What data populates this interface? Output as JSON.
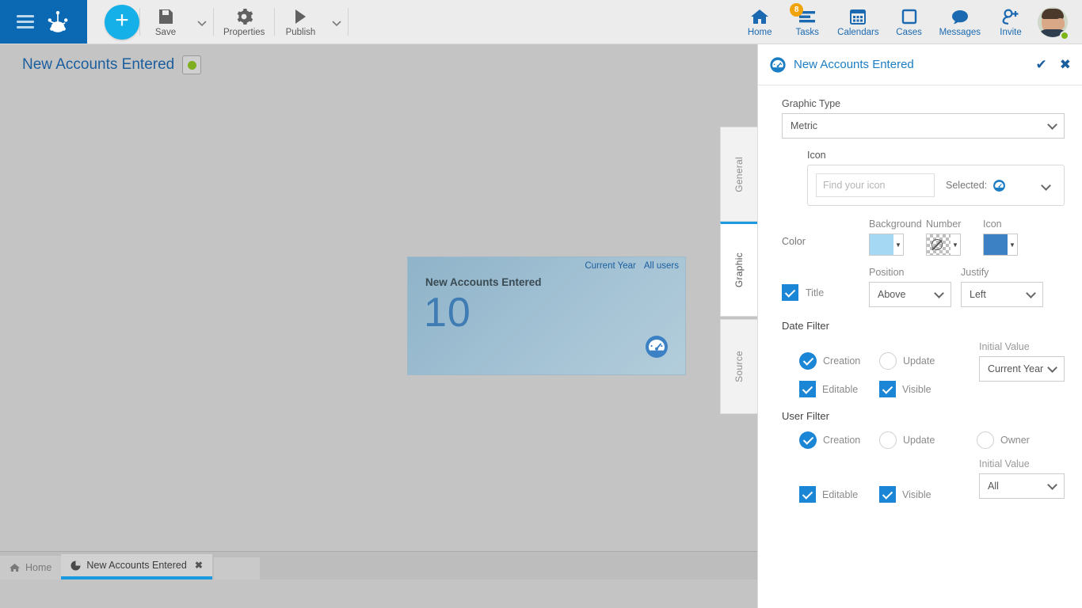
{
  "topbar": {
    "menu_icon": "hamburger-icon",
    "logo_icon": "frog-foot-logo",
    "add_label": "+",
    "left_tools": [
      {
        "label": "Save",
        "icon": "save-icon",
        "has_caret": true
      },
      {
        "label": "Properties",
        "icon": "gear-icon",
        "has_caret": false
      },
      {
        "label": "Publish",
        "icon": "play-icon",
        "has_caret": true
      }
    ],
    "right_tools": [
      {
        "label": "Home",
        "icon": "home-icon",
        "badge": ""
      },
      {
        "label": "Tasks",
        "icon": "tasks-icon",
        "badge": "8"
      },
      {
        "label": "Calendars",
        "icon": "calendar-icon",
        "badge": ""
      },
      {
        "label": "Cases",
        "icon": "square-icon",
        "badge": ""
      },
      {
        "label": "Messages",
        "icon": "speech-bubble-icon",
        "badge": ""
      },
      {
        "label": "Invite",
        "icon": "person-add-icon",
        "badge": ""
      }
    ],
    "avatar_name": "user-avatar",
    "status": "online"
  },
  "canvas": {
    "page_title": "New Accounts Entered",
    "status_color": "#7fae20",
    "widget": {
      "title": "New Accounts Entered",
      "value": "10",
      "icon": "gauge-icon",
      "date_filter": "Current Year",
      "user_filter": "All users"
    },
    "vtabs": [
      {
        "label": "General",
        "active": false
      },
      {
        "label": "Graphic",
        "active": true
      },
      {
        "label": "Source",
        "active": false
      }
    ]
  },
  "panel": {
    "icon": "gauge-icon",
    "title": "New Accounts Entered",
    "confirm_label": "✔",
    "close_label": "✖",
    "graphic_type": {
      "label": "Graphic Type",
      "value": "Metric"
    },
    "icon_section": {
      "label": "Icon",
      "search_placeholder": "Find your icon",
      "selected_label": "Selected:",
      "selected_icon": "gauge-icon"
    },
    "color": {
      "row_label": "Color",
      "background": {
        "label": "Background",
        "value": "#a5d8f3"
      },
      "number": {
        "label": "Number",
        "value": "transparent"
      },
      "icon": {
        "label": "Icon",
        "value": "#3b81c4"
      }
    },
    "title_row": {
      "title_label": "Title",
      "title_checked": true,
      "position": {
        "label": "Position",
        "value": "Above"
      },
      "justify": {
        "label": "Justify",
        "value": "Left"
      }
    },
    "date_filter": {
      "section": "Date Filter",
      "creation": {
        "label": "Creation",
        "selected": true
      },
      "update": {
        "label": "Update",
        "selected": false
      },
      "editable": {
        "label": "Editable",
        "checked": true
      },
      "visible": {
        "label": "Visible",
        "checked": true
      },
      "initial_value": {
        "label": "Initial Value",
        "value": "Current Year"
      }
    },
    "user_filter": {
      "section": "User Filter",
      "creation": {
        "label": "Creation",
        "selected": true
      },
      "update": {
        "label": "Update",
        "selected": false
      },
      "owner": {
        "label": "Owner",
        "selected": false
      },
      "editable": {
        "label": "Editable",
        "checked": true
      },
      "visible": {
        "label": "Visible",
        "checked": true
      },
      "initial_value": {
        "label": "Initial Value",
        "value": "All"
      }
    }
  },
  "taskbar": {
    "tabs": [
      {
        "label": "Home",
        "icon": "home-icon",
        "active": false,
        "closable": false
      },
      {
        "label": "New Accounts Entered",
        "icon": "pie-icon",
        "active": true,
        "closable": true,
        "close_label": "✖"
      }
    ]
  }
}
